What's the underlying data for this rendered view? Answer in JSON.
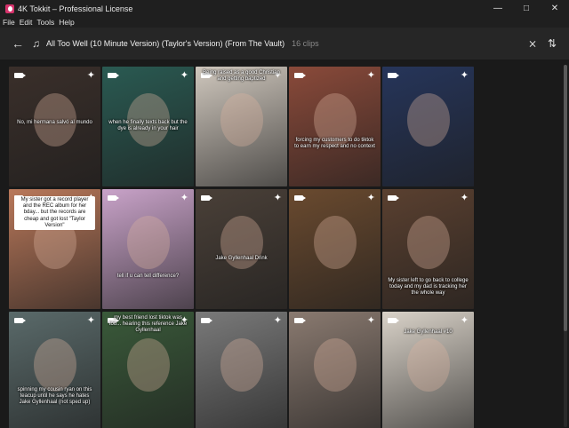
{
  "window": {
    "title": "4K Tokkit – Professional License"
  },
  "menu": [
    "File",
    "Edit",
    "Tools",
    "Help"
  ],
  "header": {
    "title": "All Too Well (10 Minute Version) (Taylor's Version) (From The Vault)",
    "count": "16 clips"
  },
  "tiles": [
    {
      "caption": "No, mi hermana salvó al mundo",
      "bg": "#3a2f2a"
    },
    {
      "caption": "when he finally texts back but the dye is already in your hair",
      "bg": "#2a5a52"
    },
    {
      "caption": "Being raised as a good Christian and getting baptized",
      "bg": "#cfc7bd"
    },
    {
      "caption": "forcing my customers to do tiktok to earn my respect and no context",
      "bg": "#8a4a3a"
    },
    {
      "caption": "",
      "bg": "#26355a"
    },
    {
      "caption": "My sister got a record player and the REC album for her bday... but the records are cheap and got lost \"Taylor Version\"",
      "bg": "#b9785a"
    },
    {
      "caption": "tell if u can tell difference?",
      "bg": "#c9a3c9"
    },
    {
      "caption": "Jake Gyllenhaal Drink",
      "bg": "#4a4038"
    },
    {
      "caption": "",
      "bg": "#6a4a2f"
    },
    {
      "caption": "My sister left to go back to college today and my dad is tracking her the whole way",
      "bg": "#5a4030"
    },
    {
      "caption": "spinning my cousin ryan on this teacup until he says he hates Jake Gyllenhaal (not sped up)",
      "bg": "#5a6a6a"
    },
    {
      "caption": "my best friend lost tiktok was too... hearing this reference Jake Gyllenhaal",
      "bg": "#3a5a3a"
    },
    {
      "caption": "",
      "bg": "#7a7a7a"
    },
    {
      "caption": "",
      "bg": "#8a7a70"
    },
    {
      "caption": "Jake Gyllenhaal #10",
      "bg": "#d9d2c8"
    }
  ]
}
